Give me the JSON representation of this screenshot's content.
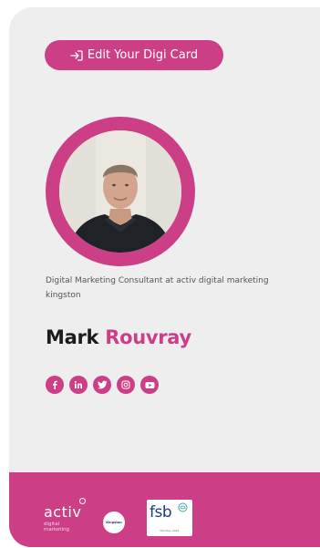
{
  "card": {
    "edit_button_label": "Edit Your Digi Card",
    "subtitle": "Digital Marketing Consultant at activ digital marketing kingston",
    "name_first": "Mark",
    "name_last": "Rouvray"
  },
  "socials": [
    {
      "icon": "facebook-icon"
    },
    {
      "icon": "linkedin-icon"
    },
    {
      "icon": "twitter-icon"
    },
    {
      "icon": "instagram-icon"
    },
    {
      "icon": "youtube-icon"
    }
  ],
  "footer": {
    "activ_word": "activ",
    "activ_sub_1": "digital",
    "activ_sub_2": "marketing",
    "kingston_badge": "Kingston",
    "fsb_word": "fsb",
    "fsb_caption": "Member 2023"
  },
  "colors": {
    "accent": "#cc3f87",
    "card_bg": "#eeeeee",
    "name_dark": "#1c1c1c"
  }
}
